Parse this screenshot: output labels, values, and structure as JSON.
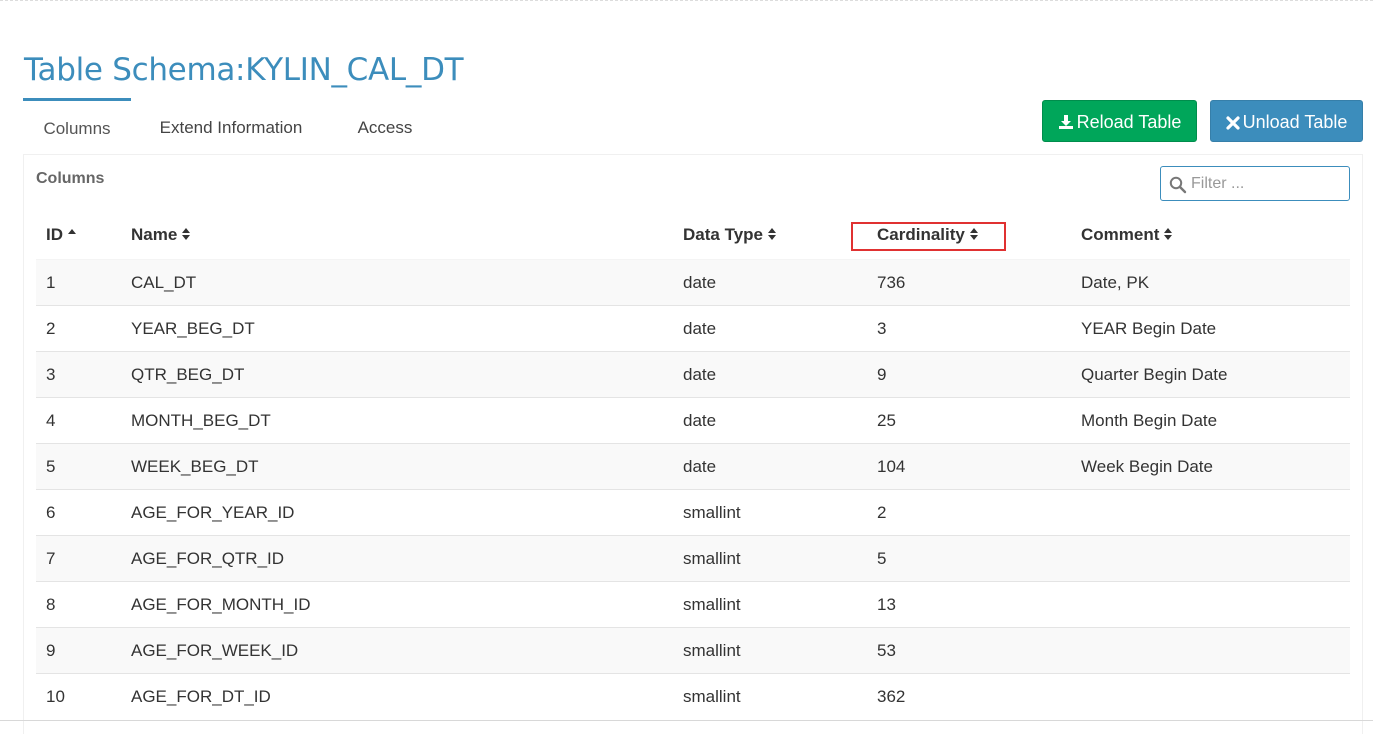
{
  "page": {
    "title": "Table Schema:KYLIN_CAL_DT"
  },
  "tabs": [
    {
      "label": "Columns",
      "active": true
    },
    {
      "label": "Extend Information",
      "active": false
    },
    {
      "label": "Access",
      "active": false
    }
  ],
  "actions": {
    "reload_label": "Reload Table",
    "reload_icon": "download-icon",
    "unload_label": "Unload Table",
    "unload_icon": "close-icon"
  },
  "columns_section": {
    "label": "Columns",
    "filter_placeholder": "Filter ...",
    "filter_value": ""
  },
  "table": {
    "headers": {
      "id": "ID",
      "name": "Name",
      "data_type": "Data Type",
      "cardinality": "Cardinality",
      "comment": "Comment"
    },
    "sort": {
      "column": "id",
      "direction": "ascending"
    },
    "highlighted_header": "cardinality",
    "rows": [
      {
        "id": "1",
        "name": "CAL_DT",
        "data_type": "date",
        "cardinality": "736",
        "comment": "Date, PK"
      },
      {
        "id": "2",
        "name": "YEAR_BEG_DT",
        "data_type": "date",
        "cardinality": "3",
        "comment": "YEAR Begin Date"
      },
      {
        "id": "3",
        "name": "QTR_BEG_DT",
        "data_type": "date",
        "cardinality": "9",
        "comment": "Quarter Begin Date"
      },
      {
        "id": "4",
        "name": "MONTH_BEG_DT",
        "data_type": "date",
        "cardinality": "25",
        "comment": "Month Begin Date"
      },
      {
        "id": "5",
        "name": "WEEK_BEG_DT",
        "data_type": "date",
        "cardinality": "104",
        "comment": "Week Begin Date"
      },
      {
        "id": "6",
        "name": "AGE_FOR_YEAR_ID",
        "data_type": "smallint",
        "cardinality": "2",
        "comment": ""
      },
      {
        "id": "7",
        "name": "AGE_FOR_QTR_ID",
        "data_type": "smallint",
        "cardinality": "5",
        "comment": ""
      },
      {
        "id": "8",
        "name": "AGE_FOR_MONTH_ID",
        "data_type": "smallint",
        "cardinality": "13",
        "comment": ""
      },
      {
        "id": "9",
        "name": "AGE_FOR_WEEK_ID",
        "data_type": "smallint",
        "cardinality": "53",
        "comment": ""
      },
      {
        "id": "10",
        "name": "AGE_FOR_DT_ID",
        "data_type": "smallint",
        "cardinality": "362",
        "comment": ""
      }
    ]
  },
  "colors": {
    "accent": "#3c8dbc",
    "success": "#00a65a",
    "highlight": "#e03131"
  }
}
